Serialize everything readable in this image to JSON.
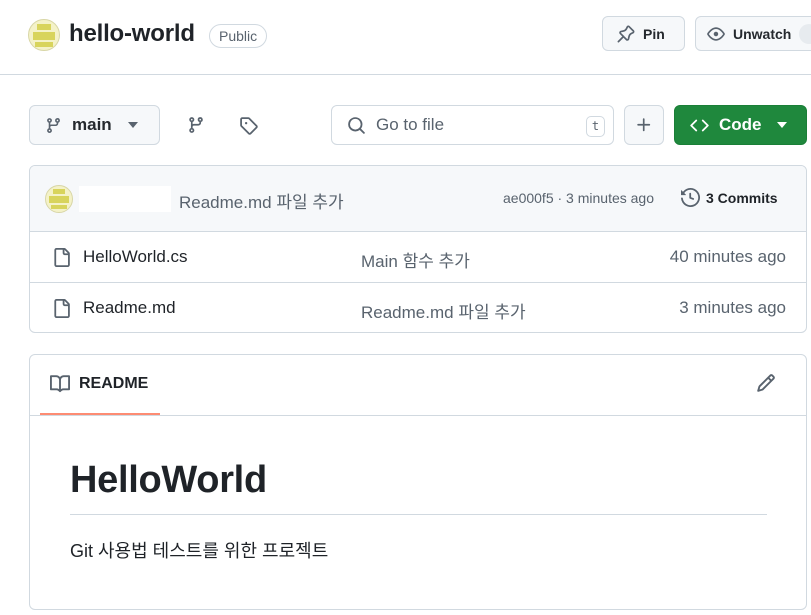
{
  "repo": {
    "name": "hello-world",
    "visibility": "Public"
  },
  "header_actions": {
    "pin_label": "Pin",
    "watch_label": "Unwatch"
  },
  "toolbar": {
    "branch": "main",
    "search_placeholder": "Go to file",
    "search_shortcut": "t",
    "code_label": "Code",
    "accent_color": "#1f883d"
  },
  "latest_commit": {
    "message": "Readme.md 파일 추가",
    "meta": "ae000f5 · 3 minutes ago",
    "commits_count_label": "3 Commits"
  },
  "files": [
    {
      "name": "HelloWorld.cs",
      "message": "Main 함수 추가",
      "age": "40 minutes ago",
      "icon": "file-icon"
    },
    {
      "name": "Readme.md",
      "message": "Readme.md 파일 추가",
      "age": "3 minutes ago",
      "icon": "file-icon"
    }
  ],
  "readme": {
    "tab_label": "README",
    "heading": "HelloWorld",
    "paragraph": "Git 사용법 테스트를 위한 프로젝트"
  }
}
